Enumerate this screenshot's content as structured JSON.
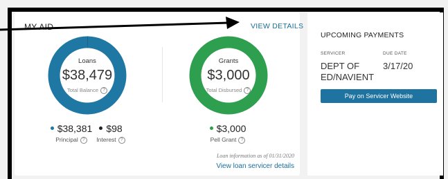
{
  "aid": {
    "title": "MY AID",
    "view_details": "VIEW DETAILS",
    "view_details_chevron": "›",
    "loans": {
      "title": "Loans",
      "value": "$38,479",
      "sub": "Total Balance",
      "principal_amount": "$38,381",
      "principal_label": "Principal",
      "interest_amount": "$98",
      "interest_label": "Interest",
      "principal_share": 0.9975,
      "interest_share": 0.0025
    },
    "grants": {
      "title": "Grants",
      "value": "$3,000",
      "sub": "Total Disbursed",
      "pell_amount": "$3,000",
      "pell_label": "Pell Grant",
      "pell_share": 1.0
    },
    "loan_info": "Loan information as of 01/31/2020",
    "servicer_link": "View loan servicer details"
  },
  "payments": {
    "title": "UPCOMING PAYMENTS",
    "servicer_header": "SERVICER",
    "due_header": "DUE DATE",
    "servicer_value": "DEPT OF ED/NAVIENT",
    "due_value": "3/17/20",
    "button_label": "Pay on Servicer Website"
  },
  "info_glyph": "?",
  "colors": {
    "loans": "#1f77a3",
    "interest": "#222222",
    "grants": "#2e9e4f",
    "link": "#1a6e9a",
    "button": "#1f73a0"
  }
}
